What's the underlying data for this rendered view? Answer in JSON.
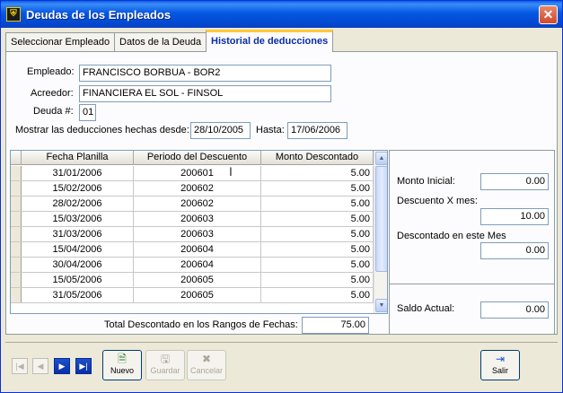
{
  "window": {
    "title": "Deudas de los Empleados",
    "close": "✕"
  },
  "tabs": [
    {
      "label": "Seleccionar Empleado"
    },
    {
      "label": "Datos de la Deuda"
    },
    {
      "label": "Historial de deducciones"
    }
  ],
  "form": {
    "empleado_label": "Empleado:",
    "empleado_value": "FRANCISCO BORBUA  -  BOR2",
    "acreedor_label": "Acreedor:",
    "acreedor_value": "FINANCIERA EL SOL  -  FINSOL",
    "deuda_label": "Deuda #:",
    "deuda_value": "01",
    "desde_label": "Mostrar las deducciones hechas desde:",
    "desde_value": "28/10/2005",
    "hasta_label": "Hasta:",
    "hasta_value": "17/06/2006"
  },
  "grid": {
    "columns": [
      "Fecha Planilla",
      "Periodo del Descuento",
      "Monto Descontado"
    ],
    "rows": [
      [
        "31/01/2006",
        "200601",
        "5.00"
      ],
      [
        "15/02/2006",
        "200602",
        "5.00"
      ],
      [
        "28/02/2006",
        "200602",
        "5.00"
      ],
      [
        "15/03/2006",
        "200603",
        "5.00"
      ],
      [
        "31/03/2006",
        "200603",
        "5.00"
      ],
      [
        "15/04/2006",
        "200604",
        "5.00"
      ],
      [
        "30/04/2006",
        "200604",
        "5.00"
      ],
      [
        "15/05/2006",
        "200605",
        "5.00"
      ],
      [
        "31/05/2006",
        "200605",
        "5.00"
      ]
    ]
  },
  "total": {
    "label": "Total Descontado en los Rangos de Fechas:",
    "value": "75.00"
  },
  "side": {
    "monto_inicial_label": "Monto Inicial:",
    "monto_inicial_value": "0.00",
    "descuento_label": "Descuento X mes:",
    "descuento_value": "10.00",
    "descontado_label": "Descontado en este Mes",
    "descontado_value": "0.00",
    "saldo_label": "Saldo Actual:",
    "saldo_value": "0.00"
  },
  "buttons": {
    "nuevo": "Nuevo",
    "guardar": "Guardar",
    "cancelar": "Cancelar",
    "salir": "Salir"
  }
}
